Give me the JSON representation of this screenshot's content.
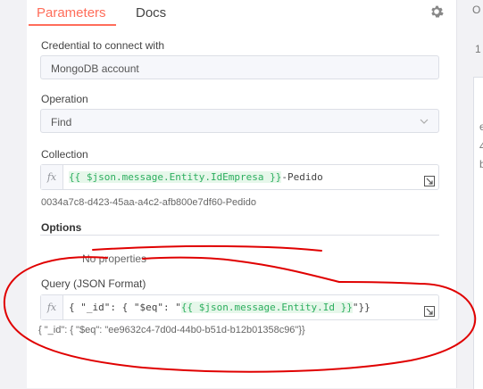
{
  "tabs": {
    "parameters": "Parameters",
    "docs": "Docs"
  },
  "credential": {
    "label": "Credential to connect with",
    "value": "MongoDB account"
  },
  "operation": {
    "label": "Operation",
    "value": "Find"
  },
  "collection": {
    "label": "Collection",
    "expr_var": "{{ $json.message.Entity.IdEmpresa }}",
    "expr_suffix": "-Pedido",
    "result": "0034a7c8-d423-45aa-a4c2-afb800e7df60-Pedido"
  },
  "options": {
    "title": "Options",
    "empty": "No properties"
  },
  "query": {
    "label": "Query (JSON Format)",
    "expr_prefix": "{ \"_id\": { \"$eq\": \"",
    "expr_var": "{{ $json.message.Entity.Id }}",
    "expr_suffix": "\"}}",
    "result": "{ \"_id\": { \"$eq\": \"ee9632c4-7d0d-44b0-b51d-b12b01358c96\"}}"
  },
  "fx_label": "fx",
  "right_panel": {
    "top": "O",
    "num": "1",
    "line1": "e",
    "line2": "4",
    "line3": "b"
  },
  "colors": {
    "accent": "#ff6d5a",
    "expression": "#2cae5e",
    "annotation": "#e00000"
  },
  "icons": {
    "settings": "gear-icon",
    "dropdown": "chevron-down-icon",
    "expand": "expand-icon"
  }
}
